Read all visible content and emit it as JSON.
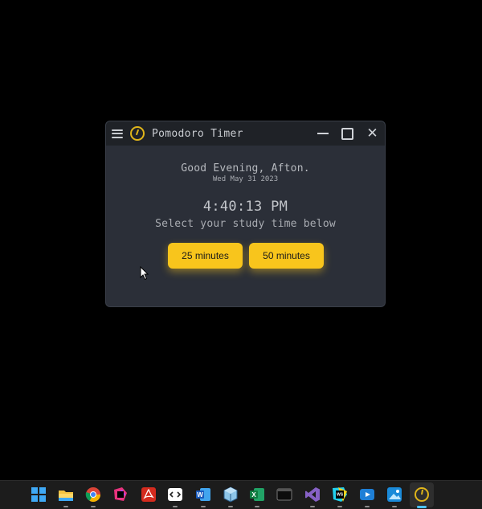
{
  "window": {
    "title": "Pomodoro Timer"
  },
  "main": {
    "greeting": "Good Evening, Afton.",
    "date": "Wed May 31 2023",
    "time": "4:40:13 PM",
    "subtitle": "Select your study time below",
    "buttons": [
      {
        "label": "25 minutes"
      },
      {
        "label": "50 minutes"
      }
    ]
  },
  "colors": {
    "accent": "#f8c51c",
    "window_bg": "#2b2f38",
    "titlebar_bg": "#1f2227",
    "desktop_bg": "#000000",
    "taskbar_bg": "#1c1c1c"
  },
  "taskbar": {
    "icons": [
      "windows-start-icon",
      "file-explorer-icon",
      "chrome-icon",
      "jetbrains-icon",
      "acrobat-icon",
      "code-editor-icon",
      "word-icon",
      "virtualbox-icon",
      "excel-icon",
      "terminal-icon",
      "visual-studio-icon",
      "webstorm-icon",
      "media-player-icon",
      "photos-icon",
      "pomodoro-timer-icon"
    ]
  }
}
